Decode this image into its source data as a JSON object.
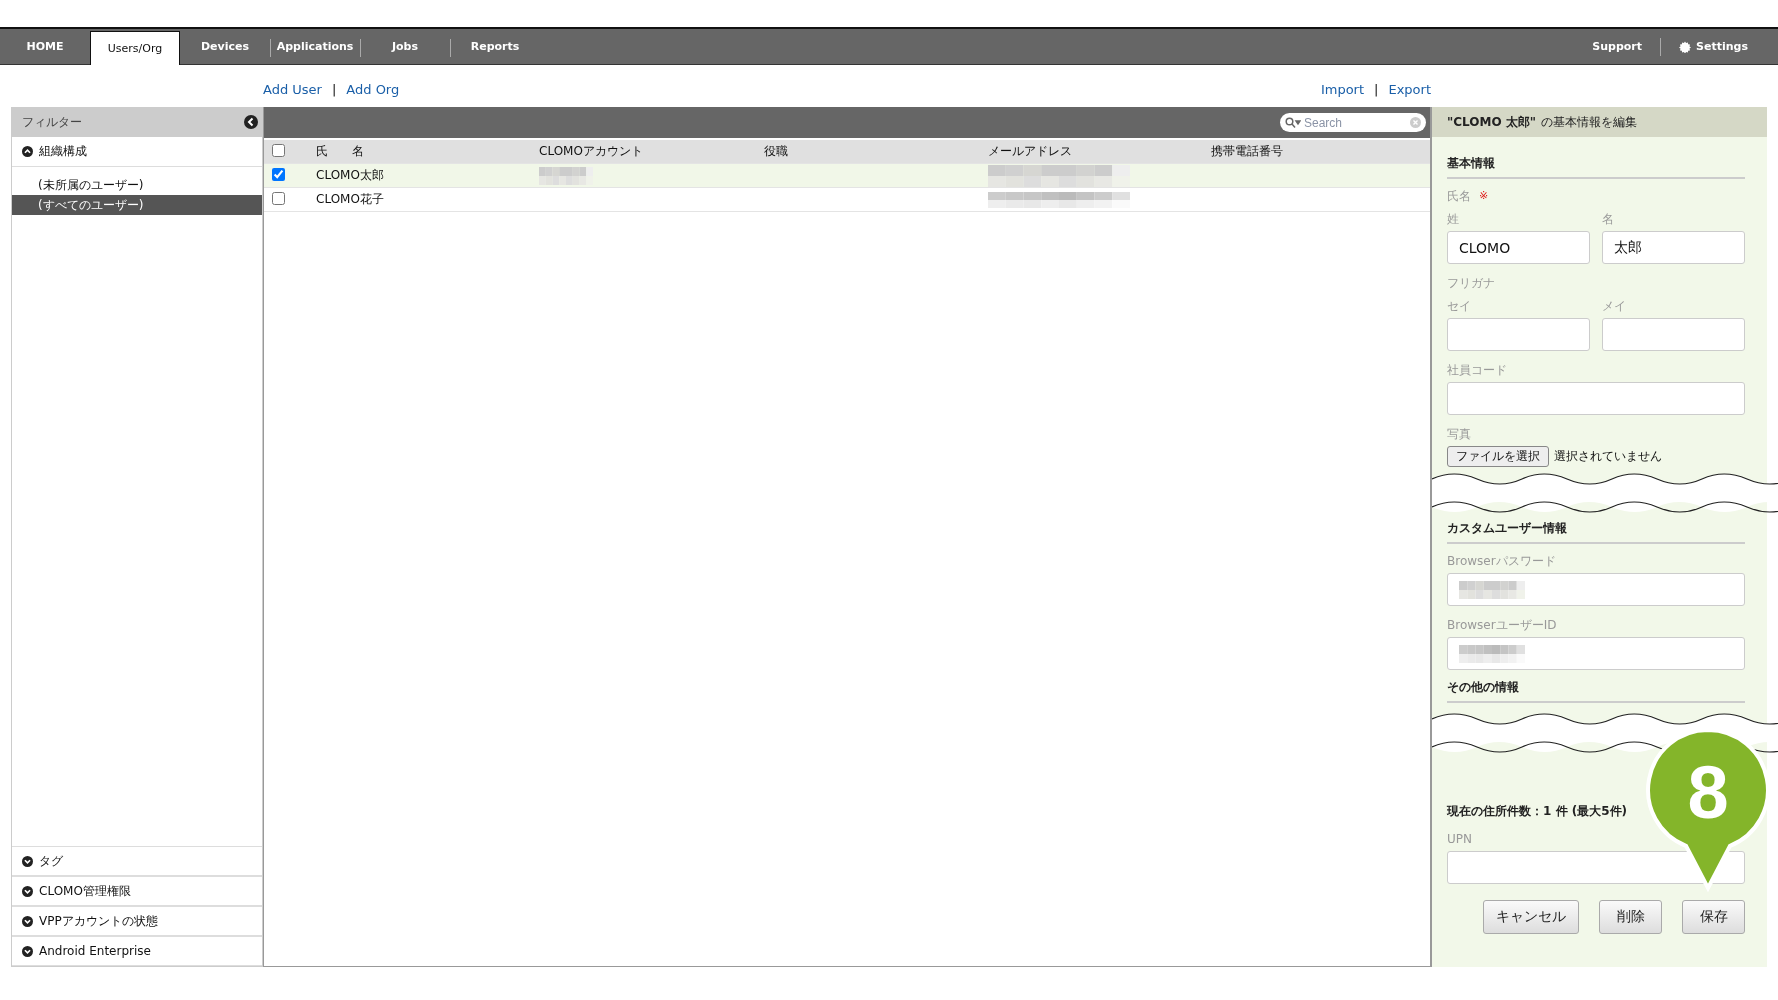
{
  "nav": {
    "tabs": [
      {
        "label": "HOME",
        "selected": false
      },
      {
        "label": "Users/Org",
        "selected": true
      },
      {
        "label": "Devices",
        "selected": false
      },
      {
        "label": "Applications",
        "selected": false
      },
      {
        "label": "Jobs",
        "selected": false
      },
      {
        "label": "Reports",
        "selected": false
      }
    ],
    "support": "Support",
    "settings": "Settings"
  },
  "actions_left": {
    "links": [
      "Add User",
      "Add Org"
    ],
    "separator": "|"
  },
  "actions_right": {
    "links": [
      "Import",
      "Export"
    ],
    "separator": "|"
  },
  "filter": {
    "title": "フィルター",
    "sections": [
      {
        "label": "組織構成",
        "expanded": true,
        "items": [
          {
            "label": "(未所属のユーザー)",
            "selected": false
          },
          {
            "label": "(すべてのユーザー)",
            "selected": true
          }
        ]
      }
    ],
    "bottom_sections": [
      {
        "label": "タグ",
        "expanded": false
      },
      {
        "label": "CLOMO管理権限",
        "expanded": false
      },
      {
        "label": "VPPアカウントの状態",
        "expanded": false
      },
      {
        "label": "Android Enterprise",
        "expanded": false
      }
    ]
  },
  "table": {
    "search": {
      "placeholder": "Search"
    },
    "all_checked": false,
    "columns": [
      "氏　　名",
      "CLOMOアカウント",
      "役職",
      "メールアドレス",
      "携帯電話番号"
    ],
    "rows": [
      {
        "name": "CLOMO太郎",
        "checked": true,
        "selected": true,
        "account": {
          "kind": "redacted"
        },
        "email": {
          "kind": "redacted"
        }
      },
      {
        "name": "CLOMO花子",
        "checked": false,
        "selected": false,
        "email": {
          "kind": "redacted"
        }
      }
    ]
  },
  "edit_panel": {
    "title": "**\"CLOMO 太郎\"** の基本情報を編集",
    "blocks": [
      {
        "kind": "heading",
        "text": "基本情報"
      },
      {
        "kind": "label",
        "text": "氏名",
        "required": "※"
      },
      {
        "kind": "pair",
        "fields": [
          {
            "label": "姓",
            "value": "CLOMO"
          },
          {
            "label": "名",
            "value": "太郎"
          }
        ]
      },
      {
        "kind": "label",
        "text": "フリガナ"
      },
      {
        "kind": "pair",
        "fields": [
          {
            "label": "セイ"
          },
          {
            "label": "メイ"
          }
        ]
      },
      {
        "kind": "field",
        "label": "社員コード"
      },
      {
        "kind": "file",
        "label": "写真",
        "button": "ファイルを選択",
        "status": "選択されていません"
      },
      {
        "kind": "tear"
      },
      {
        "kind": "heading",
        "text": "カスタムユーザー情報"
      },
      {
        "kind": "field",
        "label": "Browserパスワード",
        "redacted": true
      },
      {
        "kind": "field",
        "label": "BrowserユーザーID",
        "redacted": true
      },
      {
        "kind": "heading",
        "text": "その他の情報"
      },
      {
        "kind": "tear"
      },
      {
        "kind": "count",
        "text": "現在の住所件数：1 件 (最大5件)"
      },
      {
        "kind": "field",
        "label": "UPN"
      }
    ],
    "buttons": [
      "キャンセル",
      "削除",
      "保存"
    ]
  },
  "callout": {
    "label": "8"
  }
}
